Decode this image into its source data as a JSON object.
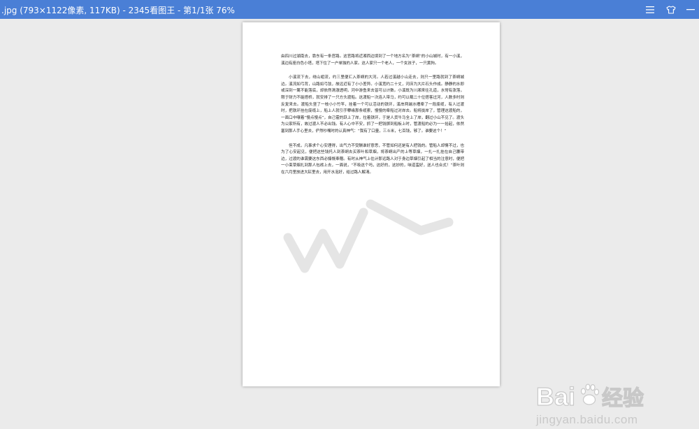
{
  "window": {
    "title": ".jpg (793×1122像素, 117KB) - 2345看图王 - 第1/1张 76%"
  },
  "controls": [
    "menu-icon",
    "skin-icon",
    "minimize-icon"
  ],
  "document": {
    "paragraphs": [
      "由四川过湖南去，靠东有一条官路。这官路将近湘西边境到了一个地方名为“茶峒”的小山城时，有一小溪，溪边有座白色小塔，塔下住了一户单独的人家。这人家只一个老人，一个女孩子，一只黄狗。",
      "小溪流下去，绕山岨流，约三里便汇入茶峒的大河。人若过溪越小山走去，则只一里路就到了茶峒城边。溪流如弓背，山路如弓弦，故远近有了小小差异。小溪宽约二十丈，河床为大片石头作成。静静的水即或深到一篙不能落底，却依然清澈透明，河中游鱼来去皆可以计数。小溪既为川湘来往孔道，水常有涨落，限于财力不能搭桥，就安排了一只方头渡船。这渡船一次连人带马，约可以载二十位搭客过河，人数多时则反复来去。渡船头竖了一枝小小竹竿，挂着一个可以活动的铁环，溪岸两端水槽牵了一段废缆，有人过渡时，把铁环挂在废缆上，船上人就引手攀缘那条缆索，慢慢的牵船过对岸去。船将拢岸了，管理这渡船的，一面口中嚷着“慢点慢点”，自己霍的跃上了岸，拉着铁环，于是人货牛马全上了岸，翻过小山不见了。渡头为公家所有，故过渡人不必出钱。有人心中不安，抓了一把钱掷到船板上时，管渡船的必为一一拾起，依然塞到那人手心里去，俨然吵嘴时的认真神气：“我有了口量，三斗米，七百钱，够了。谁要这个！”",
      "但不成，凡事求个心安理得，出气力不受酬谁好意思，不管如何还是有人把钱的。管船人却情不过，也为了心安起见，便把这些钱托人到茶峒去买茶叶和草烟，将茶峒出产的上等草烟，一扎一扎挂在自己腰带边，过渡的谁需要这东西必慷慨奉赠。有时从神气上估计那远路人对于身边草烟引起了相当的注意时，便把一小束草烟扎到那人包袱上去，一面说，“不吸这个吗，这好的，这妙的，味道蛮好，送人也合式！”茶叶则在六月里放进大缸里去，用开水泡好，给过路人解渴。"
    ]
  },
  "watermark": {
    "brand": "Bai",
    "brand_suffix": "经验",
    "url": "jingyan.baidu.com"
  }
}
